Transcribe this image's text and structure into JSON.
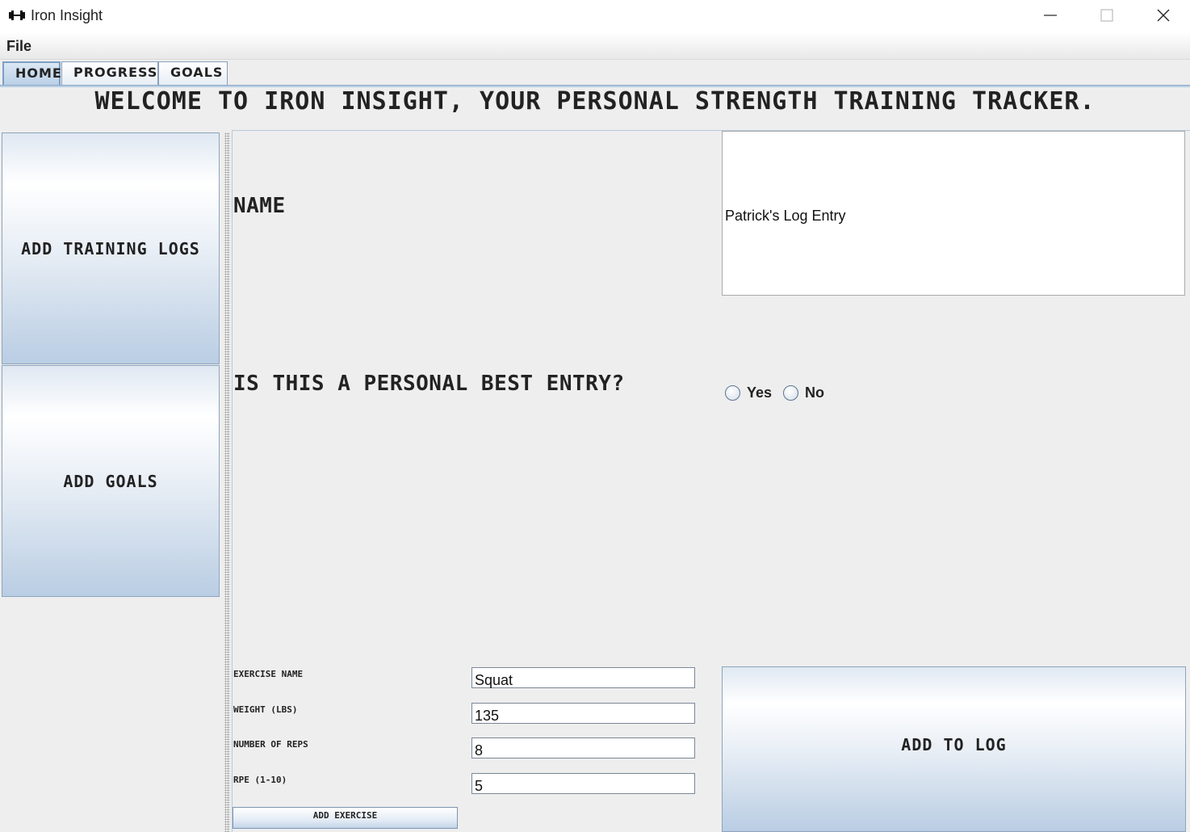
{
  "window": {
    "title": "Iron Insight",
    "icon": "dumbbell-icon"
  },
  "menu": {
    "file": "File"
  },
  "tabs": [
    {
      "label": "HOME",
      "active": true
    },
    {
      "label": "PROGRESS",
      "active": false
    },
    {
      "label": "GOALS",
      "active": false
    }
  ],
  "welcome": "Welcome to Iron Insight, your personal strength training tracker.",
  "sidebar": {
    "add_training_logs": "Add Training Logs",
    "add_goals": "Add Goals"
  },
  "form": {
    "name_label": "Name",
    "name_value": "Patrick's Log Entry",
    "personal_best_label": "Is this a personal best entry?",
    "pb_options": [
      "Yes",
      "No"
    ],
    "exercise_name_label": "Exercise Name",
    "exercise_name_value": "Squat",
    "weight_label": "Weight (lbs)",
    "weight_value": "135",
    "reps_label": "Number of reps",
    "reps_value": "8",
    "rpe_label": "RPE (1-10)",
    "rpe_value": "5",
    "add_exercise": "Add Exercise",
    "add_to_log": "Add to Log"
  },
  "colors": {
    "tab_active": "#b9cfe6",
    "button_gradient_bottom": "#b9cde3",
    "background": "#eeeeee"
  }
}
